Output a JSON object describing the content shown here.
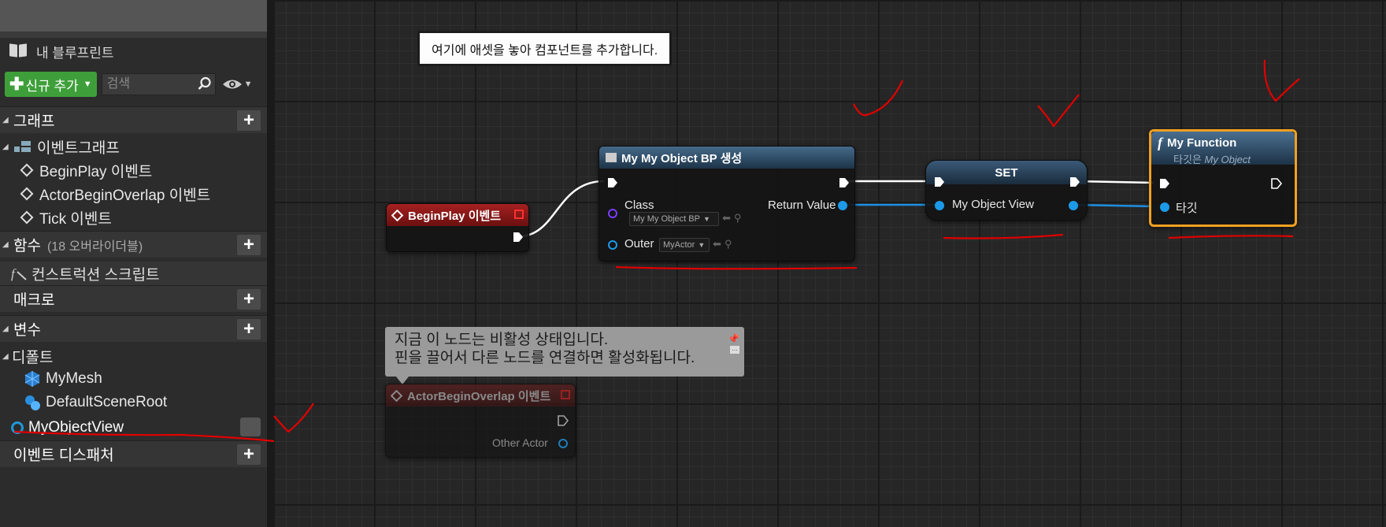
{
  "sidebar": {
    "my_blueprint_title": "내 블루프린트",
    "add_new_label": "신규 추가",
    "search_placeholder": "검색",
    "sections": {
      "graphs": "그래프",
      "functions": "함수",
      "functions_override": "(18 오버라이더블)",
      "macros": "매크로",
      "variables": "변수",
      "event_dispatchers": "이벤트 디스패처"
    },
    "event_graph_label": "이벤트그래프",
    "events": [
      "BeginPlay 이벤트",
      "ActorBeginOverlap 이벤트",
      "Tick 이벤트"
    ],
    "construction_script": "컨스트럭션 스크립트",
    "default_category": "디폴트",
    "component_vars": [
      "MyMesh",
      "DefaultSceneRoot"
    ],
    "selected_variable": "MyObjectView"
  },
  "tooltip": {
    "text": "여기에 애셋을 놓아 컴포넌트를 추가합니다."
  },
  "nodes": {
    "begin_play": {
      "title": "BeginPlay 이벤트"
    },
    "create_object": {
      "title": "My My Object BP 생성",
      "class_label": "Class",
      "class_value": "My My Object BP",
      "outer_label": "Outer",
      "outer_value": "MyActor",
      "return_label": "Return Value"
    },
    "set": {
      "title": "SET",
      "var_label": "My Object View"
    },
    "my_function": {
      "title": "My Function",
      "subtitle_prefix": "타깃은",
      "subtitle_target": "My Object",
      "target_label": "타깃"
    },
    "overlap": {
      "title": "ActorBeginOverlap 이벤트",
      "other_actor_label": "Other Actor"
    }
  },
  "comment": {
    "line1": "지금 이 노드는 비활성 상태입니다.",
    "line2": "핀을 끌어서 다른 노드를 연결하면 활성화됩니다."
  },
  "colors": {
    "accent_green": "#3e9f3a",
    "event_red": "#8b1a1a",
    "object_pin_blue": "#00a0f0",
    "class_pin_purple": "#7a3cff",
    "function_selected_orange": "#f0a020",
    "annotation_red": "#e00000"
  }
}
